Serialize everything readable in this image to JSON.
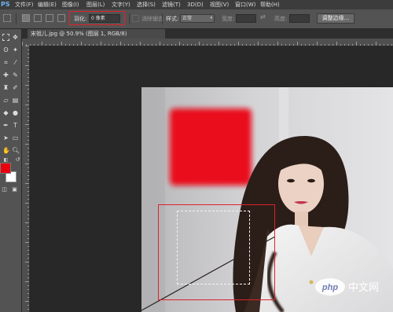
{
  "menu": {
    "logo": "PS",
    "items": [
      "文件(F)",
      "编辑(E)",
      "图像(I)",
      "图层(L)",
      "文字(Y)",
      "选择(S)",
      "滤镜(T)",
      "3D(D)",
      "视图(V)",
      "窗口(W)",
      "帮助(H)"
    ]
  },
  "options": {
    "feather_label": "羽化:",
    "feather_value": "0 像素",
    "antialias_label": "消除锯齿",
    "style_label": "样式:",
    "style_value": "正常",
    "width_label": "宽度:",
    "height_label": "高度:",
    "refine_edge_button": "调整边缘..."
  },
  "document": {
    "tab_title": "宋祖儿.jpg @ 50.9% (图层 1, RGB/8)"
  },
  "colors": {
    "foreground": "#e8000f",
    "background": "#ffffff",
    "highlight": "#e0202a"
  },
  "watermark": {
    "text": "php 中文网"
  }
}
